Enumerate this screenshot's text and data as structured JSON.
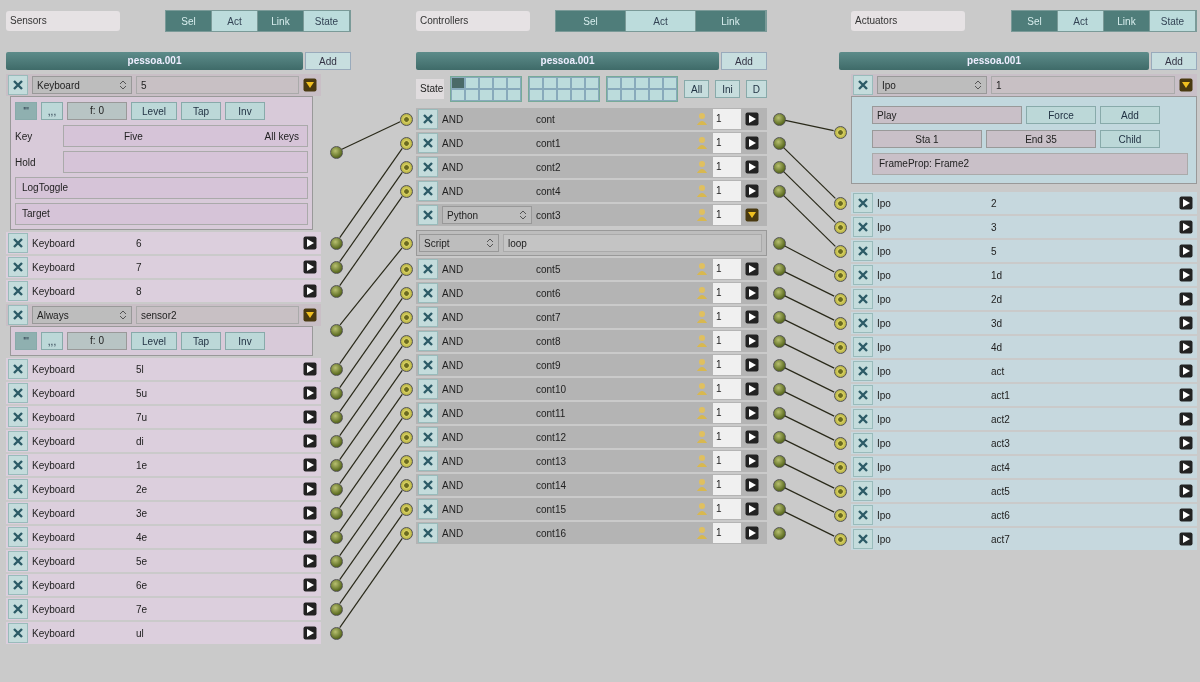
{
  "sensors": {
    "title": "Sensors",
    "tabs": [
      {
        "label": "Sel",
        "selected": true
      },
      {
        "label": "Act",
        "selected": false
      },
      {
        "label": "Link",
        "selected": true
      },
      {
        "label": "State",
        "selected": false
      }
    ],
    "object": "pessoa.001",
    "add": "Add",
    "items": [
      {
        "type": "Keyboard",
        "name": "5",
        "expanded": true,
        "details": {
          "pulse_on": "'''",
          "pulse_off": ",,,",
          "freq": "f: 0",
          "level": "Level",
          "tap": "Tap",
          "inv": "Inv",
          "key_label": "Key",
          "key": "Five",
          "all_keys": "All keys",
          "hold_label": "Hold",
          "log_toggle": "LogToggle",
          "target": "Target"
        }
      },
      {
        "type": "Keyboard",
        "name": "6",
        "expanded": false
      },
      {
        "type": "Keyboard",
        "name": "7",
        "expanded": false
      },
      {
        "type": "Keyboard",
        "name": "8",
        "expanded": false
      },
      {
        "type": "Always",
        "name": "sensor2",
        "expanded": true,
        "details": {
          "pulse_on": "'''",
          "pulse_off": ",,,",
          "freq": "f: 0",
          "level": "Level",
          "tap": "Tap",
          "inv": "Inv"
        }
      },
      {
        "type": "Keyboard",
        "name": "5l",
        "expanded": false
      },
      {
        "type": "Keyboard",
        "name": "5u",
        "expanded": false
      },
      {
        "type": "Keyboard",
        "name": "7u",
        "expanded": false
      },
      {
        "type": "Keyboard",
        "name": "di",
        "expanded": false
      },
      {
        "type": "Keyboard",
        "name": "1e",
        "expanded": false
      },
      {
        "type": "Keyboard",
        "name": "2e",
        "expanded": false
      },
      {
        "type": "Keyboard",
        "name": "3e",
        "expanded": false
      },
      {
        "type": "Keyboard",
        "name": "4e",
        "expanded": false
      },
      {
        "type": "Keyboard",
        "name": "5e",
        "expanded": false
      },
      {
        "type": "Keyboard",
        "name": "6e",
        "expanded": false
      },
      {
        "type": "Keyboard",
        "name": "7e",
        "expanded": false
      },
      {
        "type": "Keyboard",
        "name": "ul",
        "expanded": false
      }
    ]
  },
  "controllers": {
    "title": "Controllers",
    "tabs": [
      {
        "label": "Sel",
        "selected": true
      },
      {
        "label": "Act",
        "selected": false
      },
      {
        "label": "Link",
        "selected": true
      }
    ],
    "object": "pessoa.001",
    "add": "Add",
    "state_label": "State",
    "state_bits": [
      {
        "selected": true
      },
      {
        "selected": false
      },
      {
        "selected": false
      },
      {
        "selected": false
      },
      {
        "selected": false
      },
      {
        "selected": false
      },
      {
        "selected": false
      },
      {
        "selected": false
      },
      {
        "selected": false
      },
      {
        "selected": false
      },
      {
        "selected": false
      },
      {
        "selected": false
      },
      {
        "selected": false
      },
      {
        "selected": false
      },
      {
        "selected": false
      },
      {
        "selected": false
      },
      {
        "selected": false
      },
      {
        "selected": false
      },
      {
        "selected": false
      },
      {
        "selected": false
      },
      {
        "selected": false
      },
      {
        "selected": false
      },
      {
        "selected": false
      },
      {
        "selected": false
      },
      {
        "selected": false
      },
      {
        "selected": false
      },
      {
        "selected": false
      },
      {
        "selected": false
      },
      {
        "selected": false
      },
      {
        "selected": false
      }
    ],
    "state_buttons": [
      "All",
      "Ini",
      "D"
    ],
    "items": [
      {
        "type": "AND",
        "name": "cont",
        "priority": "1",
        "expanded": false
      },
      {
        "type": "AND",
        "name": "cont1",
        "priority": "1",
        "expanded": false
      },
      {
        "type": "AND",
        "name": "cont2",
        "priority": "1",
        "expanded": false
      },
      {
        "type": "AND",
        "name": "cont4",
        "priority": "1",
        "expanded": false
      },
      {
        "type": "Python",
        "name": "cont3",
        "priority": "1",
        "expanded": true,
        "script_label": "Script",
        "script": "loop"
      },
      {
        "type": "AND",
        "name": "cont5",
        "priority": "1",
        "expanded": false
      },
      {
        "type": "AND",
        "name": "cont6",
        "priority": "1",
        "expanded": false
      },
      {
        "type": "AND",
        "name": "cont7",
        "priority": "1",
        "expanded": false
      },
      {
        "type": "AND",
        "name": "cont8",
        "priority": "1",
        "expanded": false
      },
      {
        "type": "AND",
        "name": "cont9",
        "priority": "1",
        "expanded": false
      },
      {
        "type": "AND",
        "name": "cont10",
        "priority": "1",
        "expanded": false
      },
      {
        "type": "AND",
        "name": "cont11",
        "priority": "1",
        "expanded": false
      },
      {
        "type": "AND",
        "name": "cont12",
        "priority": "1",
        "expanded": false
      },
      {
        "type": "AND",
        "name": "cont13",
        "priority": "1",
        "expanded": false
      },
      {
        "type": "AND",
        "name": "cont14",
        "priority": "1",
        "expanded": false
      },
      {
        "type": "AND",
        "name": "cont15",
        "priority": "1",
        "expanded": false
      },
      {
        "type": "AND",
        "name": "cont16",
        "priority": "1",
        "expanded": false
      }
    ]
  },
  "actuators": {
    "title": "Actuators",
    "tabs": [
      {
        "label": "Sel",
        "selected": true
      },
      {
        "label": "Act",
        "selected": false
      },
      {
        "label": "Link",
        "selected": true
      },
      {
        "label": "State",
        "selected": false
      }
    ],
    "object": "pessoa.001",
    "add": "Add",
    "items": [
      {
        "type": "Ipo",
        "name": "1",
        "expanded": true,
        "details": {
          "mode": "Play",
          "force": "Force",
          "add": "Add",
          "start": "Sta 1",
          "end": "End 35",
          "child": "Child",
          "frame_prop": "FrameProp: Frame2"
        }
      },
      {
        "type": "Ipo",
        "name": "2",
        "expanded": false
      },
      {
        "type": "Ipo",
        "name": "3",
        "expanded": false
      },
      {
        "type": "Ipo",
        "name": "5",
        "expanded": false
      },
      {
        "type": "Ipo",
        "name": "1d",
        "expanded": false
      },
      {
        "type": "Ipo",
        "name": "2d",
        "expanded": false
      },
      {
        "type": "Ipo",
        "name": "3d",
        "expanded": false
      },
      {
        "type": "Ipo",
        "name": "4d",
        "expanded": false
      },
      {
        "type": "Ipo",
        "name": "act",
        "expanded": false
      },
      {
        "type": "Ipo",
        "name": "act1",
        "expanded": false
      },
      {
        "type": "Ipo",
        "name": "act2",
        "expanded": false
      },
      {
        "type": "Ipo",
        "name": "act3",
        "expanded": false
      },
      {
        "type": "Ipo",
        "name": "act4",
        "expanded": false
      },
      {
        "type": "Ipo",
        "name": "act5",
        "expanded": false
      },
      {
        "type": "Ipo",
        "name": "act6",
        "expanded": false
      },
      {
        "type": "Ipo",
        "name": "act7",
        "expanded": false
      }
    ]
  }
}
